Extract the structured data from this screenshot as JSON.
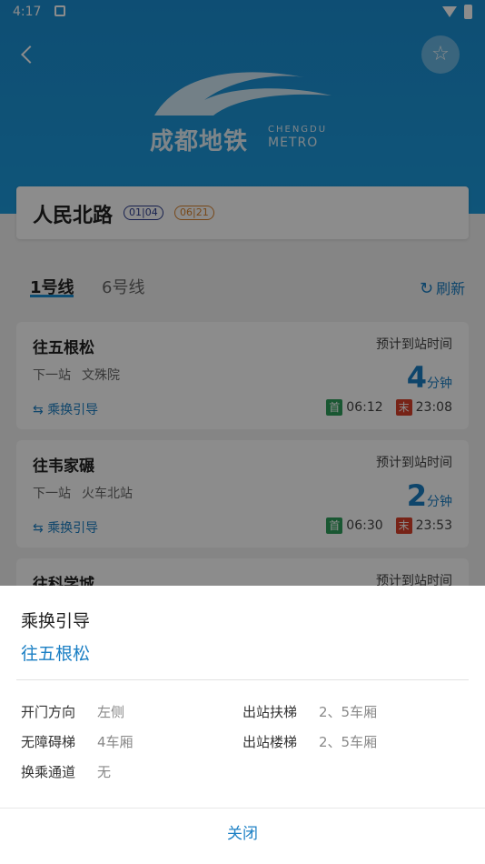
{
  "status": {
    "time": "4:17"
  },
  "header": {
    "logo_cn": "成都地铁",
    "logo_en1": "CHENGDU",
    "logo_en2": "METRO"
  },
  "station": {
    "name": "人民北路",
    "badges": [
      "01|04",
      "06|21"
    ]
  },
  "tabs": [
    {
      "label": "1号线"
    },
    {
      "label": "6号线"
    }
  ],
  "refresh_label": "刷新",
  "trains": [
    {
      "dest": "往五根松",
      "next_label": "下一站",
      "next_station": "文殊院",
      "transfer": "乘换引导",
      "arrival_label": "预计到站时间",
      "minutes": "4",
      "unit": "分钟",
      "first_tag": "首",
      "first_time": "06:12",
      "last_tag": "末",
      "last_time": "23:08"
    },
    {
      "dest": "往韦家碾",
      "next_label": "下一站",
      "next_station": "火车北站",
      "transfer": "乘换引导",
      "arrival_label": "预计到站时间",
      "minutes": "2",
      "unit": "分钟",
      "first_tag": "首",
      "first_time": "06:30",
      "last_tag": "末",
      "last_time": "23:53"
    },
    {
      "dest": "往科学城",
      "arrival_label": "预计到站时间"
    }
  ],
  "sheet": {
    "title": "乘换引导",
    "subtitle": "往五根松",
    "rows": [
      {
        "label": "开门方向",
        "value": "左侧"
      },
      {
        "label": "出站扶梯",
        "value": "2、5车厢"
      },
      {
        "label": "无障碍梯",
        "value": "4车厢"
      },
      {
        "label": "出站楼梯",
        "value": "2、5车厢"
      },
      {
        "label": "换乘通道",
        "value": "无"
      }
    ],
    "close_label": "关闭"
  },
  "colors": {
    "primary": "#1b7fc4",
    "header_bg": "#1d9bdd",
    "first_tag": "#2e9e5b",
    "last_tag": "#d9412b"
  }
}
